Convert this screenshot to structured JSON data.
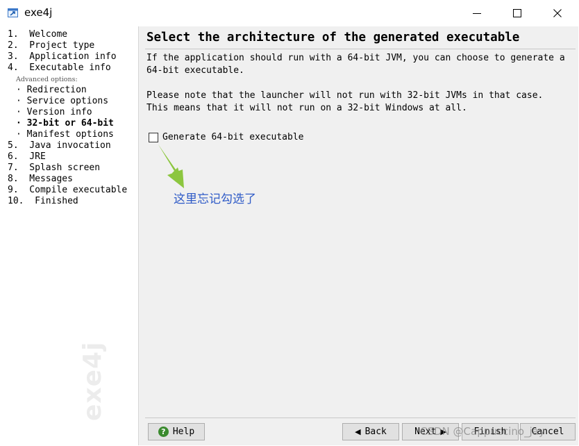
{
  "window": {
    "title": "exe4j"
  },
  "sidebar": {
    "steps": [
      {
        "label": "1.  Welcome"
      },
      {
        "label": "2.  Project type"
      },
      {
        "label": "3.  Application info"
      },
      {
        "label": "4.  Executable info"
      },
      {
        "label": "· Redirection"
      },
      {
        "label": "· Service options"
      },
      {
        "label": "· Version info"
      },
      {
        "label": "· 32-bit or 64-bit"
      },
      {
        "label": "· Manifest options"
      },
      {
        "label": "5.  Java invocation"
      },
      {
        "label": "6.  JRE"
      },
      {
        "label": "7.  Splash screen"
      },
      {
        "label": "8.  Messages"
      },
      {
        "label": "9.  Compile executable"
      },
      {
        "label": "10.  Finished"
      }
    ],
    "advanced_label": "Advanced options:",
    "watermark": "exe4j"
  },
  "main": {
    "heading": "Select the architecture of the generated executable",
    "para1_line1": "If the application should run with a 64-bit JVM, you can choose to generate a",
    "para1_line2": "64-bit executable.",
    "para2_line1": "Please note that the launcher will not run with 32-bit JVMs in that case.",
    "para2_line2": "This means that it will not run on a 32-bit Windows at all.",
    "checkbox_label": "Generate 64-bit executable",
    "checkbox_checked": false,
    "annotation": "这里忘记勾选了",
    "annotation_color": "#2f5bc7",
    "arrow_color": "#8cc63f"
  },
  "buttons": {
    "help": "Help",
    "back": "Back",
    "next": "Next",
    "finish": "Finish",
    "cancel": "Cancel"
  },
  "watermark_csdn": "CSDN @Cappuccino_jay"
}
